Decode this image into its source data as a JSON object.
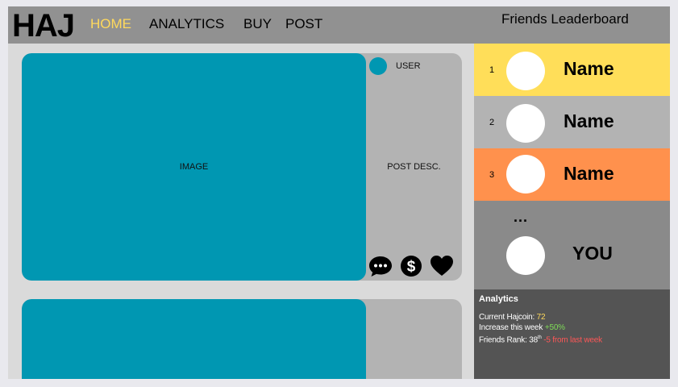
{
  "header": {
    "logo": "HAJ",
    "nav": [
      {
        "label": "HOME",
        "active": true
      },
      {
        "label": "ANALYTICS",
        "active": false
      },
      {
        "label": "BUY",
        "active": false
      },
      {
        "label": "POST",
        "active": false
      }
    ],
    "leaderboard_title": "Friends Leaderboard"
  },
  "posts": [
    {
      "image_label": "IMAGE",
      "user_label": "USER",
      "description_label": "POST DESC.",
      "actions": [
        "comment-icon",
        "dollar-icon",
        "heart-icon"
      ]
    },
    {}
  ],
  "leaderboard": {
    "entries": [
      {
        "rank": "1",
        "name": "Name",
        "color": "#ffde59"
      },
      {
        "rank": "2",
        "name": "Name",
        "color": "#b3b3b3"
      },
      {
        "rank": "3",
        "name": "Name",
        "color": "#ff914d"
      }
    ],
    "ellipsis": "...",
    "you": {
      "name": "YOU"
    }
  },
  "analytics": {
    "title": "Analytics",
    "hajcoin_label": "Current Hajcoin:",
    "hajcoin_value": "72",
    "increase_label": "Increase this week",
    "increase_value": "+50%",
    "rank_label": "Friends Rank:",
    "rank_value": "38",
    "rank_suffix": "th",
    "rank_change": "-5 from last week"
  },
  "colors": {
    "accent_teal": "#0097b2",
    "nav_active": "#ffd95c",
    "positive": "#7ed957",
    "negative": "#ff5757"
  }
}
